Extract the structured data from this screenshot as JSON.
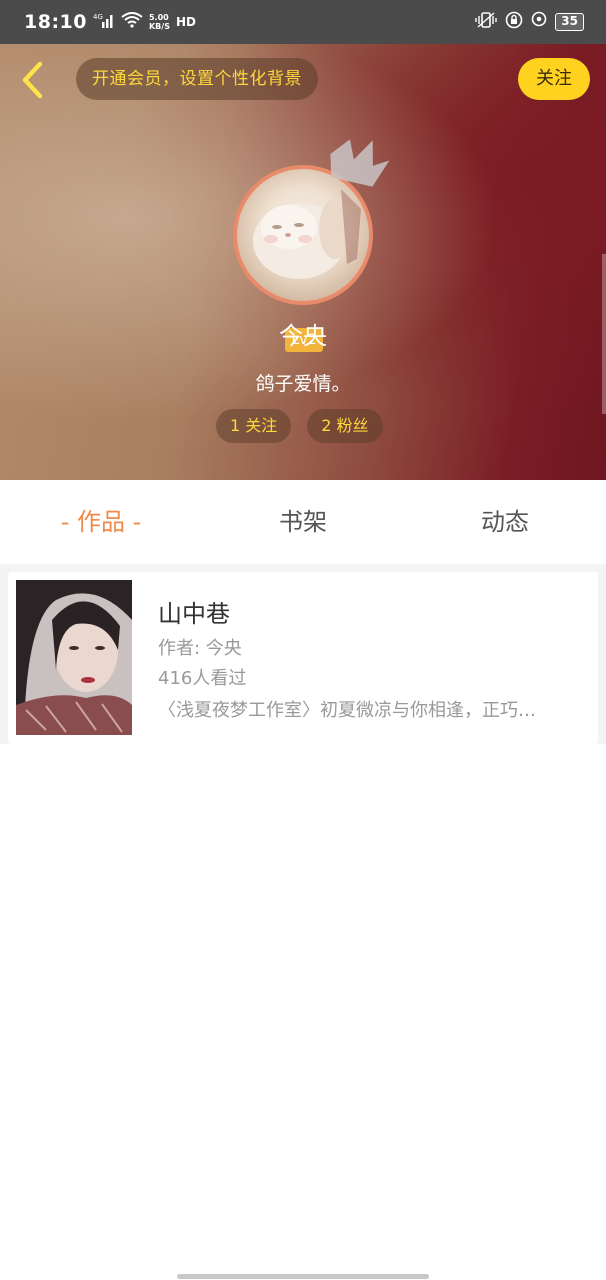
{
  "status_bar": {
    "time": "18:10",
    "net_speed_value": "5.00",
    "net_speed_unit": "KB/S",
    "hd_label": "HD",
    "network_label": "4G",
    "battery": "35"
  },
  "header": {
    "vip_banner": "开通会员，设置个性化背景",
    "follow_label": "关注",
    "level": "Lv2",
    "username": "今央",
    "bio": "鸽子爱情。",
    "following": "1 关注",
    "followers": "2 粉丝"
  },
  "tabs": [
    {
      "label": "- 作品 -",
      "active": true
    },
    {
      "label": "书架",
      "active": false
    },
    {
      "label": "动态",
      "active": false
    }
  ],
  "books": [
    {
      "title": "山中巷",
      "author": "作者: 今央",
      "views": "416人看过",
      "description": "〈浅夏夜梦工作室〉初夏微凉与你相逢，正巧…"
    }
  ],
  "colors": {
    "accent_orange": "#f08a4b",
    "follow_yellow": "#ffd21f",
    "banner_text": "#ffd83a",
    "level_badge": "#f3b43c"
  },
  "icons": {
    "back": "chevron-left-icon",
    "crown": "crown-icon"
  }
}
